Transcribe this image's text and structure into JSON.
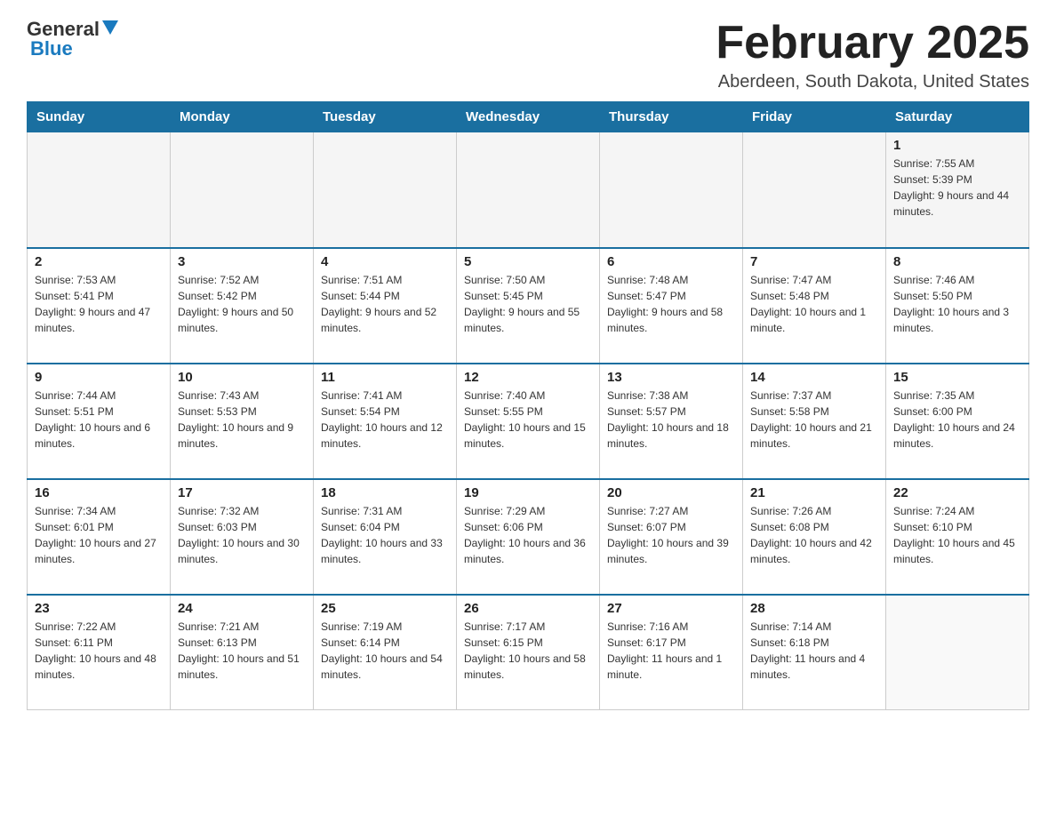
{
  "header": {
    "logo_general": "General",
    "logo_blue": "Blue",
    "month_title": "February 2025",
    "location": "Aberdeen, South Dakota, United States"
  },
  "days_of_week": [
    "Sunday",
    "Monday",
    "Tuesday",
    "Wednesday",
    "Thursday",
    "Friday",
    "Saturday"
  ],
  "weeks": [
    [
      {
        "day": "",
        "info": ""
      },
      {
        "day": "",
        "info": ""
      },
      {
        "day": "",
        "info": ""
      },
      {
        "day": "",
        "info": ""
      },
      {
        "day": "",
        "info": ""
      },
      {
        "day": "",
        "info": ""
      },
      {
        "day": "1",
        "info": "Sunrise: 7:55 AM\nSunset: 5:39 PM\nDaylight: 9 hours and 44 minutes."
      }
    ],
    [
      {
        "day": "2",
        "info": "Sunrise: 7:53 AM\nSunset: 5:41 PM\nDaylight: 9 hours and 47 minutes."
      },
      {
        "day": "3",
        "info": "Sunrise: 7:52 AM\nSunset: 5:42 PM\nDaylight: 9 hours and 50 minutes."
      },
      {
        "day": "4",
        "info": "Sunrise: 7:51 AM\nSunset: 5:44 PM\nDaylight: 9 hours and 52 minutes."
      },
      {
        "day": "5",
        "info": "Sunrise: 7:50 AM\nSunset: 5:45 PM\nDaylight: 9 hours and 55 minutes."
      },
      {
        "day": "6",
        "info": "Sunrise: 7:48 AM\nSunset: 5:47 PM\nDaylight: 9 hours and 58 minutes."
      },
      {
        "day": "7",
        "info": "Sunrise: 7:47 AM\nSunset: 5:48 PM\nDaylight: 10 hours and 1 minute."
      },
      {
        "day": "8",
        "info": "Sunrise: 7:46 AM\nSunset: 5:50 PM\nDaylight: 10 hours and 3 minutes."
      }
    ],
    [
      {
        "day": "9",
        "info": "Sunrise: 7:44 AM\nSunset: 5:51 PM\nDaylight: 10 hours and 6 minutes."
      },
      {
        "day": "10",
        "info": "Sunrise: 7:43 AM\nSunset: 5:53 PM\nDaylight: 10 hours and 9 minutes."
      },
      {
        "day": "11",
        "info": "Sunrise: 7:41 AM\nSunset: 5:54 PM\nDaylight: 10 hours and 12 minutes."
      },
      {
        "day": "12",
        "info": "Sunrise: 7:40 AM\nSunset: 5:55 PM\nDaylight: 10 hours and 15 minutes."
      },
      {
        "day": "13",
        "info": "Sunrise: 7:38 AM\nSunset: 5:57 PM\nDaylight: 10 hours and 18 minutes."
      },
      {
        "day": "14",
        "info": "Sunrise: 7:37 AM\nSunset: 5:58 PM\nDaylight: 10 hours and 21 minutes."
      },
      {
        "day": "15",
        "info": "Sunrise: 7:35 AM\nSunset: 6:00 PM\nDaylight: 10 hours and 24 minutes."
      }
    ],
    [
      {
        "day": "16",
        "info": "Sunrise: 7:34 AM\nSunset: 6:01 PM\nDaylight: 10 hours and 27 minutes."
      },
      {
        "day": "17",
        "info": "Sunrise: 7:32 AM\nSunset: 6:03 PM\nDaylight: 10 hours and 30 minutes."
      },
      {
        "day": "18",
        "info": "Sunrise: 7:31 AM\nSunset: 6:04 PM\nDaylight: 10 hours and 33 minutes."
      },
      {
        "day": "19",
        "info": "Sunrise: 7:29 AM\nSunset: 6:06 PM\nDaylight: 10 hours and 36 minutes."
      },
      {
        "day": "20",
        "info": "Sunrise: 7:27 AM\nSunset: 6:07 PM\nDaylight: 10 hours and 39 minutes."
      },
      {
        "day": "21",
        "info": "Sunrise: 7:26 AM\nSunset: 6:08 PM\nDaylight: 10 hours and 42 minutes."
      },
      {
        "day": "22",
        "info": "Sunrise: 7:24 AM\nSunset: 6:10 PM\nDaylight: 10 hours and 45 minutes."
      }
    ],
    [
      {
        "day": "23",
        "info": "Sunrise: 7:22 AM\nSunset: 6:11 PM\nDaylight: 10 hours and 48 minutes."
      },
      {
        "day": "24",
        "info": "Sunrise: 7:21 AM\nSunset: 6:13 PM\nDaylight: 10 hours and 51 minutes."
      },
      {
        "day": "25",
        "info": "Sunrise: 7:19 AM\nSunset: 6:14 PM\nDaylight: 10 hours and 54 minutes."
      },
      {
        "day": "26",
        "info": "Sunrise: 7:17 AM\nSunset: 6:15 PM\nDaylight: 10 hours and 58 minutes."
      },
      {
        "day": "27",
        "info": "Sunrise: 7:16 AM\nSunset: 6:17 PM\nDaylight: 11 hours and 1 minute."
      },
      {
        "day": "28",
        "info": "Sunrise: 7:14 AM\nSunset: 6:18 PM\nDaylight: 11 hours and 4 minutes."
      },
      {
        "day": "",
        "info": ""
      }
    ]
  ]
}
